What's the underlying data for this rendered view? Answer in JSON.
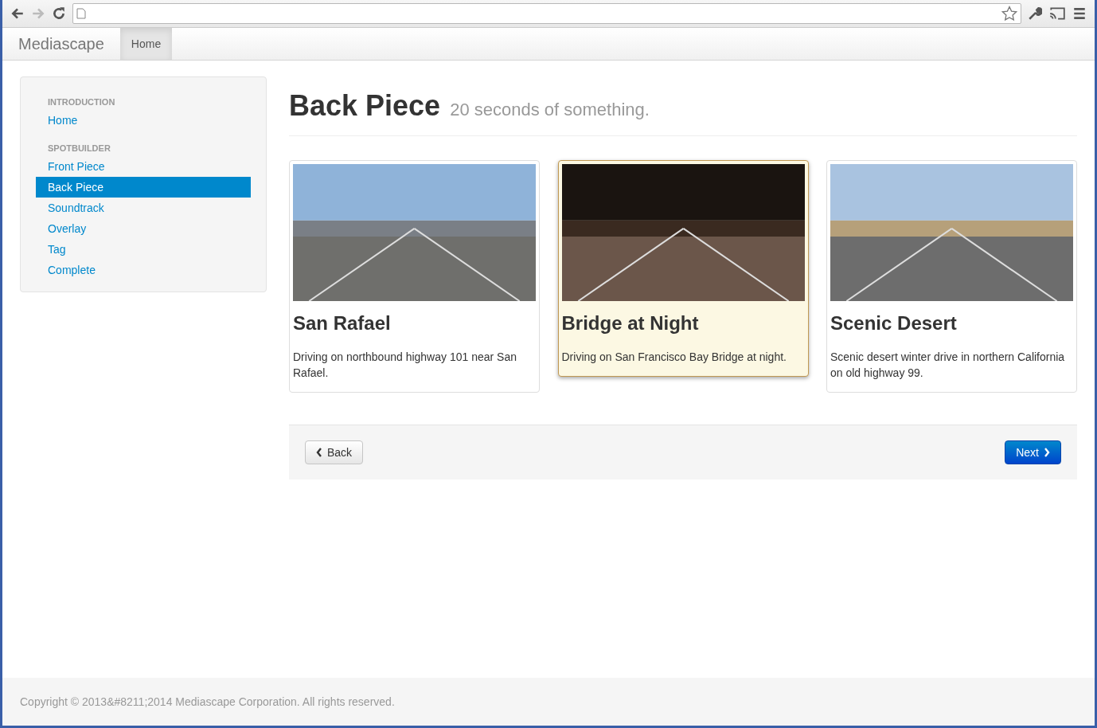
{
  "navbar": {
    "brand": "Mediascape",
    "tabs": [
      {
        "label": "Home",
        "selected": true
      }
    ]
  },
  "sidebar": {
    "sections": [
      {
        "heading": "INTRODUCTION",
        "items": [
          {
            "label": "Home",
            "selected": false
          }
        ]
      },
      {
        "heading": "SPOTBUILDER",
        "items": [
          {
            "label": "Front Piece",
            "selected": false
          },
          {
            "label": "Back Piece",
            "selected": true
          },
          {
            "label": "Soundtrack",
            "selected": false
          },
          {
            "label": "Overlay",
            "selected": false
          },
          {
            "label": "Tag",
            "selected": false
          },
          {
            "label": "Complete",
            "selected": false
          }
        ]
      }
    ]
  },
  "page": {
    "title": "Back Piece",
    "subtitle": "20 seconds of something."
  },
  "clips": [
    {
      "title": "San Rafael",
      "description": "Driving on northbound highway 101 near San Rafael.",
      "selected": false
    },
    {
      "title": "Bridge at Night",
      "description": "Driving on San Francisco Bay Bridge at night.",
      "selected": true
    },
    {
      "title": "Scenic Desert",
      "description": "Scenic desert winter drive in northern California on old highway 99.",
      "selected": false
    }
  ],
  "actions": {
    "back": "Back",
    "next": "Next"
  },
  "footer": "Copyright © 2013&#8211;2014 Mediascape Corporation. All rights reserved."
}
